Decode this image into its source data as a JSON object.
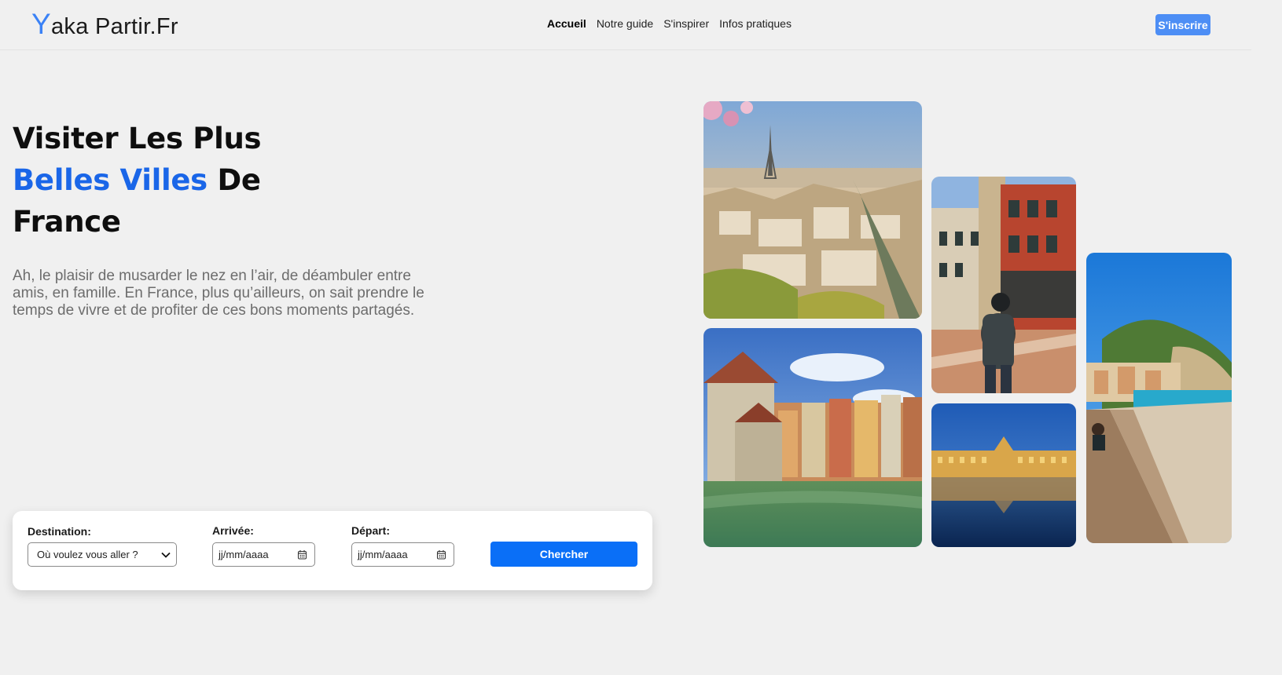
{
  "header": {
    "logo_initial": "Y",
    "logo_rest": "aka Partir.Fr",
    "nav": [
      {
        "label": "Accueil",
        "active": true
      },
      {
        "label": "Notre guide",
        "active": false
      },
      {
        "label": "S'inspirer",
        "active": false
      },
      {
        "label": "Infos pratiques",
        "active": false
      }
    ],
    "signup_label": "S'inscrire"
  },
  "hero": {
    "title_line1": "Visiter Les Plus",
    "title_accent": "Belles Villes",
    "title_line2_rest": " De",
    "title_line3": "France",
    "description": "Ah, le plaisir de musarder le nez en l’air, de déambuler entre amis, en famille. En France, plus qu’ailleurs, on sait prendre le temps de vivre et de profiter de ces bons moments partagés."
  },
  "search": {
    "destination_label": "Destination:",
    "destination_value": "Où voulez vous aller ?",
    "arrival_label": "Arrivée:",
    "arrival_value": "jj/mm/aaaa",
    "departure_label": "Départ:",
    "departure_value": "jj/mm/aaaa",
    "button_label": "Chercher"
  },
  "gallery": [
    {
      "name": "paris-photo",
      "icon": "eiffel-tower"
    },
    {
      "name": "annecy-photo",
      "icon": "canal-town"
    },
    {
      "name": "lille-photo",
      "icon": "flemish-square"
    },
    {
      "name": "bordeaux-photo",
      "icon": "water-mirror"
    },
    {
      "name": "nice-photo",
      "icon": "beach"
    }
  ],
  "colors": {
    "accent": "#1a66e8",
    "signup_bg": "#4d8ef5",
    "search_button": "#0a6ff7",
    "background": "#f0f0f0"
  }
}
